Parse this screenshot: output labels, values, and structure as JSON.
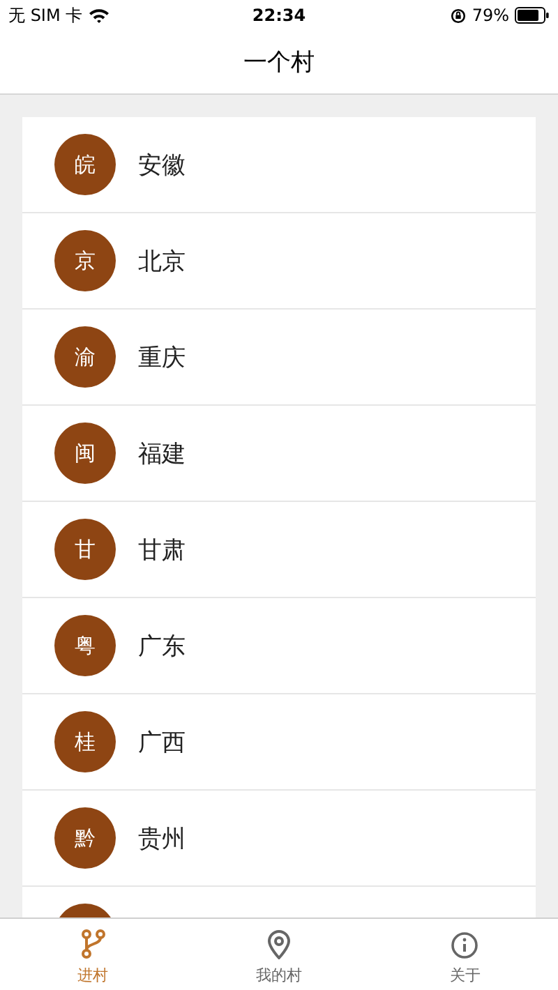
{
  "status_bar": {
    "carrier": "无 SIM 卡",
    "time": "22:34",
    "battery": "79%"
  },
  "nav": {
    "title": "一个村"
  },
  "provinces": [
    {
      "abbr": "皖",
      "name": "安徽"
    },
    {
      "abbr": "京",
      "name": "北京"
    },
    {
      "abbr": "渝",
      "name": "重庆"
    },
    {
      "abbr": "闽",
      "name": "福建"
    },
    {
      "abbr": "甘",
      "name": "甘肃"
    },
    {
      "abbr": "粤",
      "name": "广东"
    },
    {
      "abbr": "桂",
      "name": "广西"
    },
    {
      "abbr": "黔",
      "name": "贵州"
    }
  ],
  "tabs": [
    {
      "label": "进村",
      "kind": "branch",
      "selected": true
    },
    {
      "label": "我的村",
      "kind": "pin",
      "selected": false
    },
    {
      "label": "关于",
      "kind": "info",
      "selected": false
    }
  ]
}
